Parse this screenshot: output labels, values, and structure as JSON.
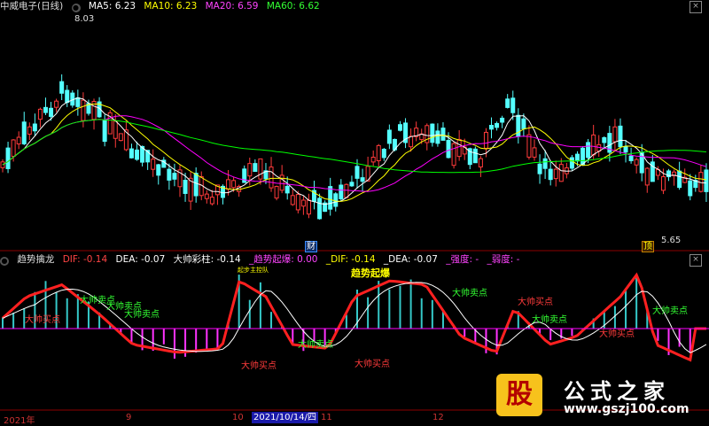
{
  "main_header": {
    "stock": "中威电子(日线)",
    "ma5": "MA5: 6.23",
    "ma10": "MA10: 6.23",
    "ma20": "MA20: 6.59",
    "ma60": "MA60: 6.62"
  },
  "main_annotations": {
    "high": "8.03",
    "low": "5.65",
    "cai_label": "财",
    "ding_label": "顶"
  },
  "indicator_header": {
    "name": "趋势擒龙",
    "dif": "DIF: -0.14",
    "dea": "DEA: -0.07",
    "dashuai": "大帅彩柱: -0.14",
    "qidong": "_趋势起爆: 0.00",
    "dif2": "_DIF: -0.14",
    "dea2": "_DEA: -0.07",
    "qiangdu": "_强度: -",
    "ruodu": "_弱度: -"
  },
  "indicator_annotations": {
    "qibao_big": "趋势起爆",
    "qibao_small": "起步主控队",
    "sell1": "大帅卖点",
    "sell2": "大帅卖点",
    "sell3": "大帅卖点",
    "buy1": "大帅买点",
    "buy2": "大帅买点",
    "buy3": "大帅买点",
    "sell4": "大帅卖点",
    "sell5": "大帅卖点",
    "buy4": "大帅买点",
    "buy5": "大帅买点"
  },
  "x_axis": {
    "year": "2021年",
    "m9": "9",
    "m10": "10",
    "date": "2021/10/14/四",
    "m11": "11",
    "m12": "12"
  },
  "watermark": {
    "logo": "股",
    "title": "公式之家",
    "url": "www.gszj100.com"
  },
  "colors": {
    "up": "#ff3b3b",
    "down": "#54ffff",
    "ma5": "#ffffff",
    "ma10": "#ffff00",
    "ma20": "#ff00ff",
    "ma60": "#00ff00",
    "macd_line": "#ff2020",
    "signal_line": "#ffffff"
  }
}
